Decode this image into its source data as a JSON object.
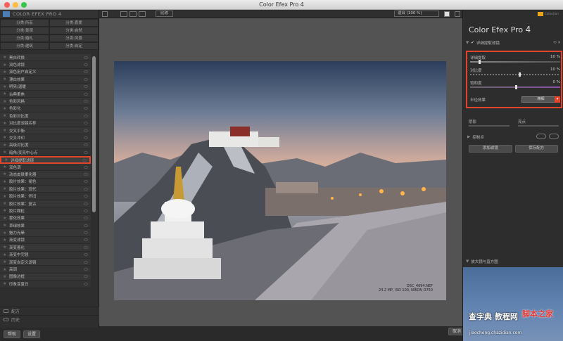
{
  "window": {
    "title": "Color Efex Pro 4"
  },
  "left_panel": {
    "brand": "COLOR EFEX PRO 4",
    "categories": [
      "分类:所有",
      "分类:喜爱",
      "分类:景观",
      "分类:自然",
      "分类:婚礼",
      "分类:风景",
      "分类:建筑",
      "分类:自定"
    ],
    "filters": [
      "黑白转换",
      "双色滤镜",
      "双色用户自定义",
      "漂白效果",
      "明亮/温暖",
      "古典柔焦",
      "色彩风格",
      "色彩化",
      "色彩对比度",
      "对比度滤镜名称",
      "交叉平衡",
      "交叉冲印",
      "高级对比度",
      "暗角/变亮中心点",
      "详细提取滤镜",
      "双色调",
      "动态皮肤柔化器",
      "胶片效果：褪色",
      "胶片效果：现代",
      "胶片效果：怀旧",
      "胶片效果：复古",
      "胶片颗粒",
      "雾化效果",
      "草绿效果",
      "魅力光晕",
      "渐变滤镜",
      "渐变着化",
      "渐变中完镜",
      "渐变自定义滤镜",
      "高调",
      "图像边框",
      "印象变夏日"
    ],
    "selected_filter": "详细提取滤镜",
    "bottom": {
      "recipes": "配方",
      "history": "历史"
    },
    "footer": {
      "help": "帮助",
      "settings": "设置"
    }
  },
  "toolbar": {
    "compare": "比较",
    "zoom": "适合 (100 %)"
  },
  "photo_meta": {
    "filename": "DSC_4694.NEF",
    "info": "24.2 MP, ISO 100, NIKON D750"
  },
  "canvas_footer": {
    "cancel": "取消"
  },
  "right_panel": {
    "brand_small": "Collection",
    "app_title": "Color Efex Pro",
    "app_version": "4",
    "filter_name": "详细提取滤镜",
    "params": [
      {
        "label": "详细提取",
        "value": "10 %",
        "level": 0.1
      },
      {
        "label": "对比度",
        "value": "10 %",
        "level": 0.55
      },
      {
        "label": "饱和度",
        "value": "0 %",
        "level": 0.5
      }
    ],
    "grain_label": "半径效果",
    "grain_value": "精细",
    "shadow_label": "阴影",
    "highlight_label": "亮点",
    "control_points": "控制点",
    "add_filter": "添加滤镜",
    "save_recipe": "保存配方",
    "loupe_title": "放大镜与直方图"
  },
  "watermark": {
    "main": "查字典 教程网",
    "sub": "jiaocheng.chazidian.com",
    "logo": "脚本之家"
  },
  "colors": {
    "accent": "#e3452c",
    "panel": "#2e2e2e",
    "canvas": "#535353"
  }
}
